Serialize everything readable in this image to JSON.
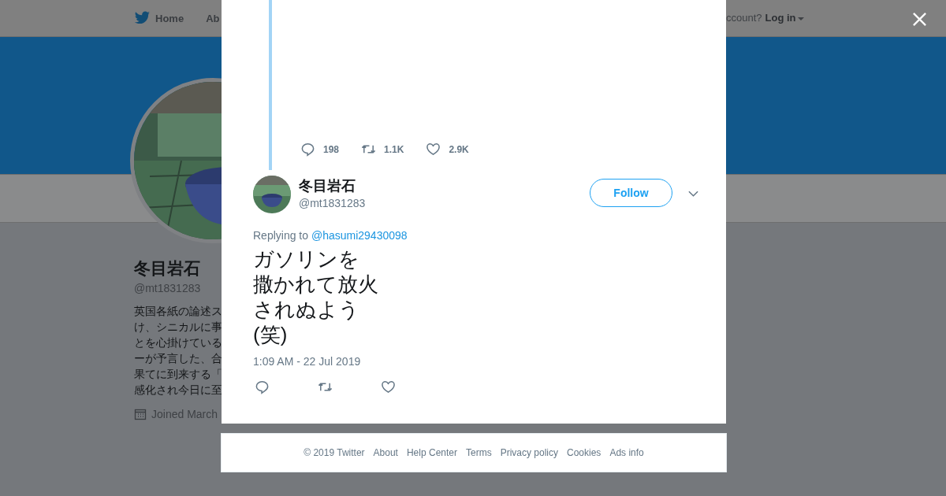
{
  "top_nav": {
    "items": [
      {
        "label": "Home",
        "kind": "home"
      },
      {
        "label": "Ab",
        "kind": "plain"
      }
    ],
    "account_prompt": "ccount?",
    "login": "Log in"
  },
  "profile": {
    "avatar": {
      "kind": "picture"
    },
    "name": "冬目岩石",
    "handle": "@mt1831283",
    "bio_lines": [
      "英国各紙の論述ス",
      "け、シニカルに事",
      "とを心掛けている",
      "ーが予言した、合",
      "果てに到来する「",
      "感化され今日に至"
    ],
    "joined": "Joined March"
  },
  "modal": {
    "parent_stats": [
      {
        "kind": "reply",
        "count": "198"
      },
      {
        "kind": "retweet",
        "count": "1.1K"
      },
      {
        "kind": "like",
        "count": "2.9K"
      }
    ],
    "tweet": {
      "avatar": {
        "kind": "picture"
      },
      "name": "冬目岩石",
      "handle": "@mt1831283",
      "follow": "Follow",
      "replying_prefix": "Replying to",
      "replying_to": "@hasumi29430098",
      "text_lines": [
        "ガソリンを",
        "撒かれて放火",
        "されぬよう",
        "(笑)"
      ],
      "timestamp": "1:09 AM - 22 Jul 2019",
      "actions": [
        {
          "kind": "reply"
        },
        {
          "kind": "retweet"
        },
        {
          "kind": "like"
        }
      ]
    }
  },
  "footer": [
    "© 2019 Twitter",
    "About",
    "Help Center",
    "Terms",
    "Privacy policy",
    "Cookies",
    "Ads info"
  ]
}
